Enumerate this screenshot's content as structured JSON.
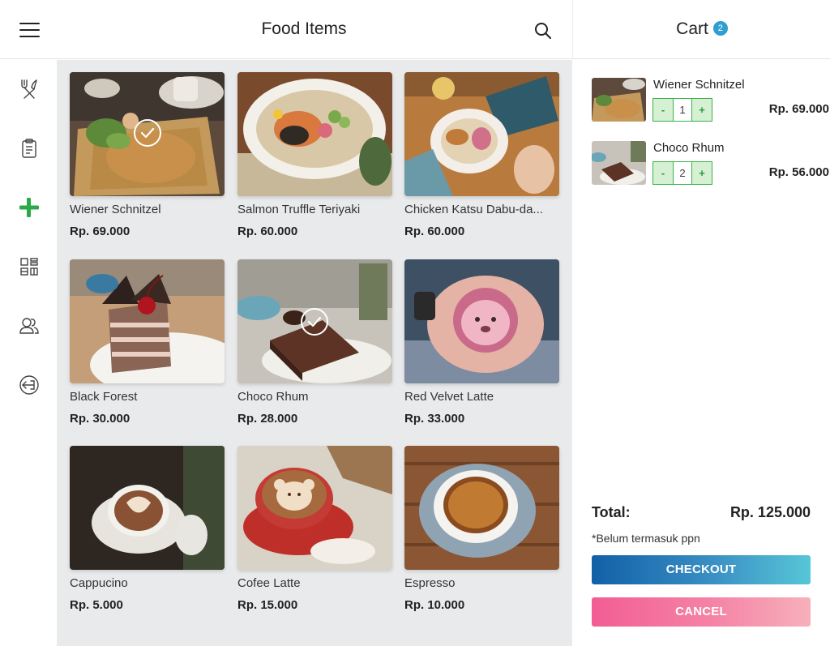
{
  "header": {
    "title": "Food Items",
    "menu_icon": "hamburger-icon",
    "search_icon": "search-icon"
  },
  "cart_header": {
    "title": "Cart",
    "count": "2"
  },
  "sidebar": {
    "items": [
      {
        "icon": "utensils-icon",
        "active": false
      },
      {
        "icon": "clipboard-icon",
        "active": false
      },
      {
        "icon": "plus-icon",
        "active": true
      },
      {
        "icon": "grid-icon",
        "active": false
      },
      {
        "icon": "users-icon",
        "active": false
      },
      {
        "icon": "logout-icon",
        "active": false
      }
    ],
    "active_color": "#2aa84a"
  },
  "products": [
    {
      "name": "Wiener Schnitzel",
      "price": "Rp. 69.000",
      "selected": true
    },
    {
      "name": "Salmon Truffle Teriyaki",
      "price": "Rp. 60.000",
      "selected": false
    },
    {
      "name": "Chicken Katsu Dabu-da...",
      "price": "Rp. 60.000",
      "selected": false
    },
    {
      "name": "Black Forest",
      "price": "Rp. 30.000",
      "selected": false
    },
    {
      "name": "Choco Rhum",
      "price": "Rp. 28.000",
      "selected": true
    },
    {
      "name": "Red Velvet Latte",
      "price": "Rp. 33.000",
      "selected": false
    },
    {
      "name": "Cappucino",
      "price": "Rp. 5.000",
      "selected": false
    },
    {
      "name": "Cofee Latte",
      "price": "Rp. 15.000",
      "selected": false
    },
    {
      "name": "Espresso",
      "price": "Rp. 10.000",
      "selected": false
    }
  ],
  "cart": {
    "items": [
      {
        "name": "Wiener Schnitzel",
        "qty": "1",
        "minus": "-",
        "plus": "+",
        "price": "Rp. 69.000"
      },
      {
        "name": "Choco Rhum",
        "qty": "2",
        "minus": "-",
        "plus": "+",
        "price": "Rp. 56.000"
      }
    ],
    "total_label": "Total:",
    "total_value": "Rp. 125.000",
    "tax_note": "*Belum termasuk ppn",
    "checkout_label": "CHECKOUT",
    "cancel_label": "CANCEL"
  },
  "colors": {
    "accent_green": "#3bb34a",
    "badge_blue": "#2f9fd0",
    "checkout_gradient": [
      "#1160a8",
      "#57c6d8"
    ],
    "cancel_gradient": [
      "#f25d93",
      "#f7b0bb"
    ],
    "grid_background": "#e9eaec"
  }
}
